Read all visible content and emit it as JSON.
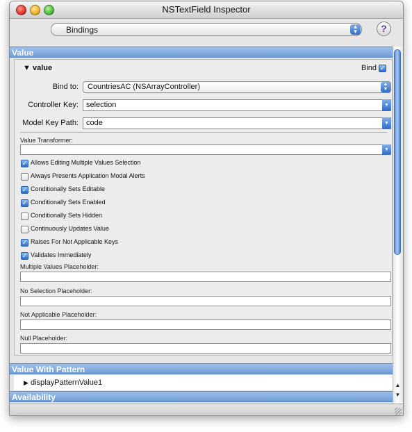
{
  "window": {
    "title": "NSTextField Inspector"
  },
  "toolbar": {
    "pane_popup": "Bindings",
    "help_label": "?"
  },
  "sections": {
    "value": "Value",
    "value_with_pattern": "Value With Pattern",
    "availability": "Availability"
  },
  "binding": {
    "name": "value",
    "bind_label": "Bind",
    "bind_checked": true,
    "bind_to_label": "Bind to:",
    "bind_to_value": "CountriesAC (NSArrayController)",
    "controller_key_label": "Controller Key:",
    "controller_key_value": "selection",
    "model_key_path_label": "Model Key Path:",
    "model_key_path_value": "code",
    "value_transformer_label": "Value Transformer:",
    "value_transformer_value": ""
  },
  "options": [
    {
      "label": "Allows Editing Multiple Values Selection",
      "checked": true
    },
    {
      "label": "Always Presents Application Modal Alerts",
      "checked": false
    },
    {
      "label": "Conditionally Sets Editable",
      "checked": true
    },
    {
      "label": "Conditionally Sets Enabled",
      "checked": true
    },
    {
      "label": "Conditionally Sets Hidden",
      "checked": false
    },
    {
      "label": "Continuously Updates Value",
      "checked": false
    },
    {
      "label": "Raises For Not Applicable Keys",
      "checked": true
    },
    {
      "label": "Validates Immediately",
      "checked": true
    }
  ],
  "placeholders": [
    {
      "label": "Multiple Values Placeholder:",
      "value": ""
    },
    {
      "label": "No Selection Placeholder:",
      "value": ""
    },
    {
      "label": "Not Applicable Placeholder:",
      "value": ""
    },
    {
      "label": "Null Placeholder:",
      "value": ""
    }
  ],
  "pattern": {
    "item": "displayPatternValue1"
  },
  "colors": {
    "section_header": "#7fa8de",
    "check_blue": "#2f6cc9"
  }
}
